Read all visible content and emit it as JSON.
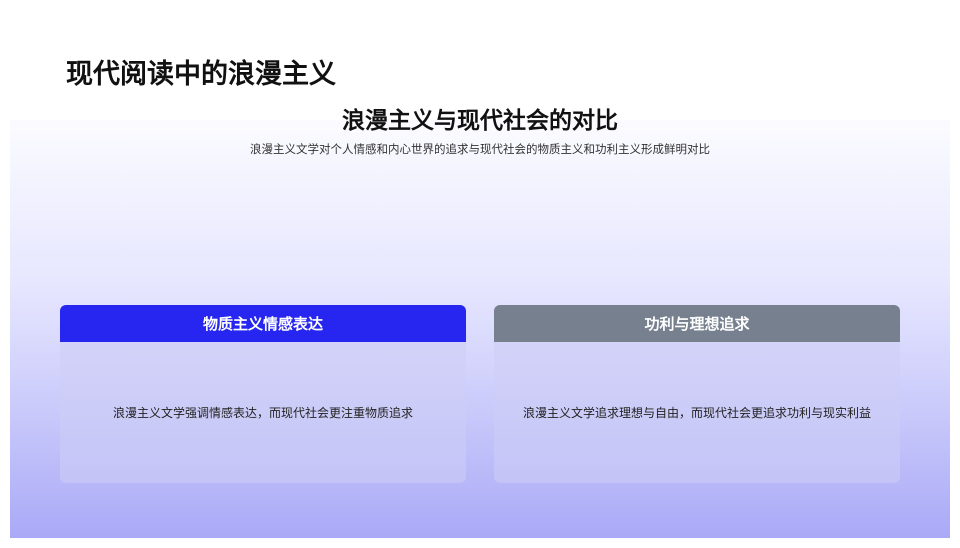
{
  "page_title": "现代阅读中的浪漫主义",
  "section": {
    "title": "浪漫主义与现代社会的对比",
    "subtitle": "浪漫主义文学对个人情感和内心世界的追求与现代社会的物质主义和功利主义形成鲜明对比"
  },
  "cards": [
    {
      "title": "物质主义情感表达",
      "body": "浪漫主义文学强调情感表达，而现代社会更注重物质追求",
      "header_color": "#2626f0"
    },
    {
      "title": "功利与理想追求",
      "body": "浪漫主义文学追求理想与自由，而现代社会更追求功利与现实利益",
      "header_color": "#76808f"
    }
  ]
}
